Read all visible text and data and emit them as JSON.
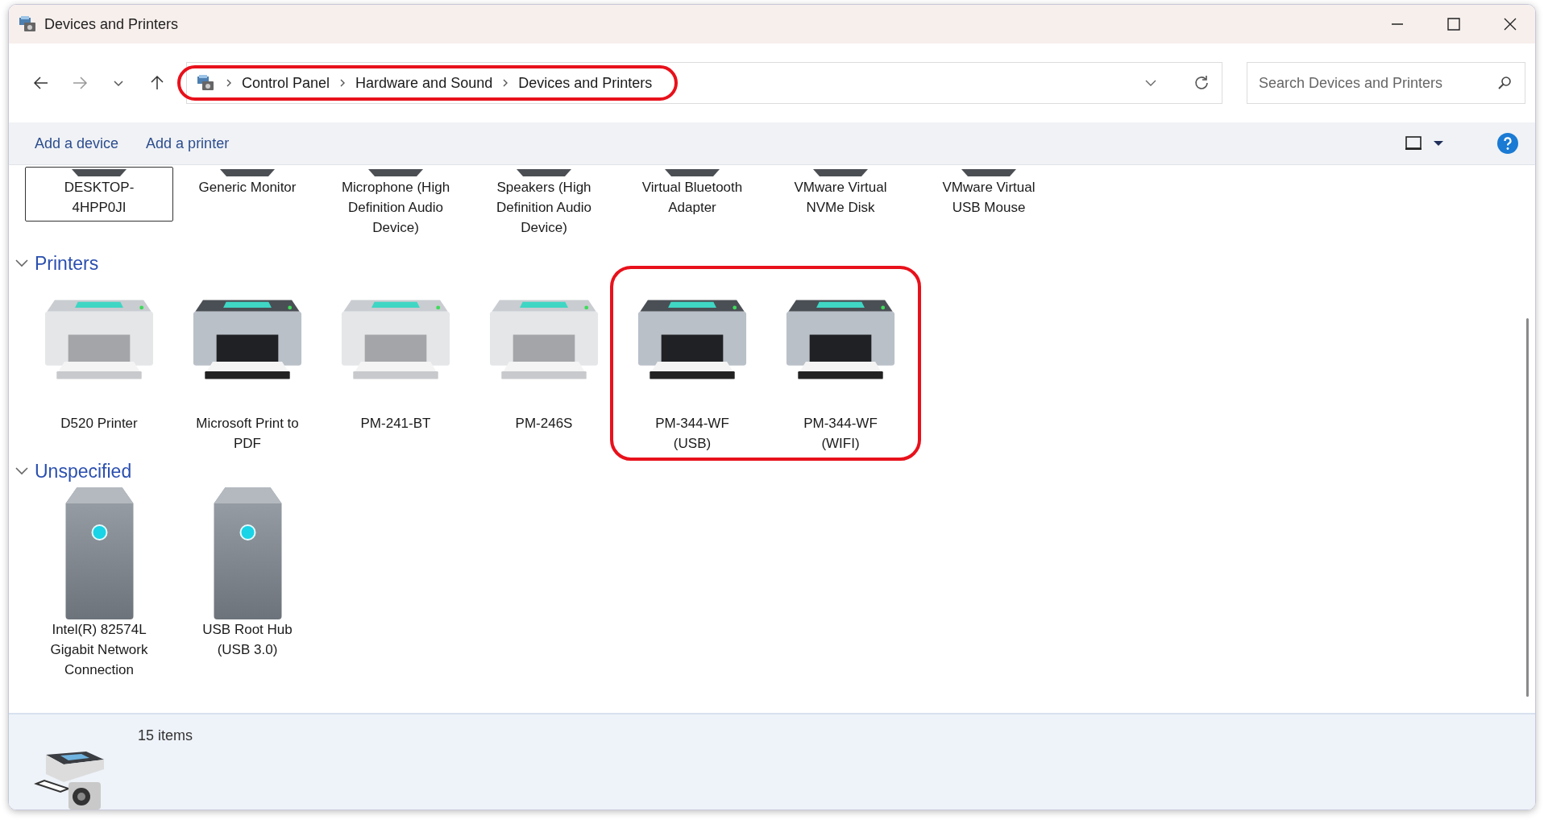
{
  "window": {
    "title": "Devices and Printers"
  },
  "address_bar": {
    "breadcrumbs": [
      "Control Panel",
      "Hardware and Sound",
      "Devices and Printers"
    ],
    "annotated": true
  },
  "search": {
    "placeholder": "Search Devices and Printers"
  },
  "commands": [
    "Add a device",
    "Add a printer"
  ],
  "devices": [
    {
      "label": "DESKTOP-4HPP0JI",
      "selected": true
    },
    {
      "label": "Generic Monitor",
      "selected": false
    },
    {
      "label": "Microphone (High Definition Audio Device)",
      "selected": false
    },
    {
      "label": "Speakers (High Definition Audio Device)",
      "selected": false
    },
    {
      "label": "Virtual Bluetooth Adapter",
      "selected": false
    },
    {
      "label": "VMware Virtual NVMe Disk",
      "selected": false
    },
    {
      "label": "VMware Virtual USB Mouse",
      "selected": false
    }
  ],
  "groups": [
    {
      "name": "Printers",
      "expanded": true,
      "items": [
        {
          "label": "D520 Printer",
          "kind": "printer-light",
          "annotated": false
        },
        {
          "label": "Microsoft Print to PDF",
          "kind": "printer-dark",
          "annotated": false
        },
        {
          "label": "PM-241-BT",
          "kind": "printer-light",
          "annotated": false
        },
        {
          "label": "PM-246S",
          "kind": "printer-light",
          "annotated": false
        },
        {
          "label": "PM-344-WF (USB)",
          "kind": "printer-dark",
          "annotated": true
        },
        {
          "label": "PM-344-WF (WIFI)",
          "kind": "printer-dark",
          "annotated": true
        }
      ]
    },
    {
      "name": "Unspecified",
      "expanded": true,
      "items": [
        {
          "label": "Intel(R) 82574L Gigabit Network Connection",
          "kind": "tower",
          "annotated": false
        },
        {
          "label": "USB Root Hub (USB 3.0)",
          "kind": "tower",
          "annotated": false
        }
      ]
    }
  ],
  "status_bar": {
    "count": "15 items"
  }
}
